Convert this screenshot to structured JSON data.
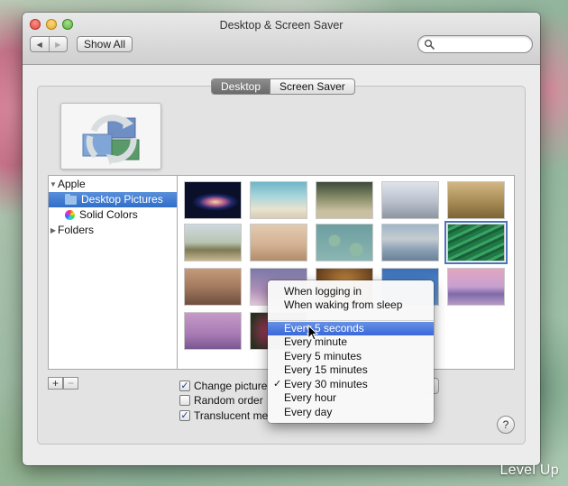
{
  "window": {
    "title": "Desktop & Screen Saver"
  },
  "toolbar": {
    "back_icon": "chevron-left-icon",
    "forward_icon": "chevron-right-icon",
    "show_all_label": "Show All",
    "search_placeholder": "",
    "search_icon": "magnifier-icon"
  },
  "tabs": [
    {
      "label": "Desktop",
      "active": true
    },
    {
      "label": "Screen Saver",
      "active": false
    }
  ],
  "sidebar": {
    "items": [
      {
        "label": "Apple",
        "expanded": true
      },
      {
        "label": "Desktop Pictures",
        "selected": true
      },
      {
        "label": "Solid Colors"
      },
      {
        "label": "Folders",
        "expanded": false
      }
    ]
  },
  "list_buttons": {
    "add_label": "+",
    "remove_label": "−"
  },
  "options": {
    "change_picture_label": "Change picture",
    "change_picture_checked": true,
    "random_order_label": "Random order",
    "random_order_checked": false,
    "translucent_menu_label": "Translucent me",
    "translucent_menu_checked": true
  },
  "interval_menu": {
    "items": [
      {
        "label": "When logging in"
      },
      {
        "label": "When waking from sleep"
      },
      {
        "label": "Every 5 seconds",
        "highlighted": true
      },
      {
        "label": "Every minute"
      },
      {
        "label": "Every 5 minutes"
      },
      {
        "label": "Every 15 minutes"
      },
      {
        "label": "Every 30 minutes",
        "checked": true
      },
      {
        "label": "Every hour"
      },
      {
        "label": "Every day"
      }
    ],
    "check_mark": "✓"
  },
  "help_label": "?",
  "watermark": "Level Up",
  "colors": {
    "selection_blue": "#2f6ec8",
    "menu_highlight": "#3a68d8",
    "tab_active": "#6a6a6a"
  }
}
